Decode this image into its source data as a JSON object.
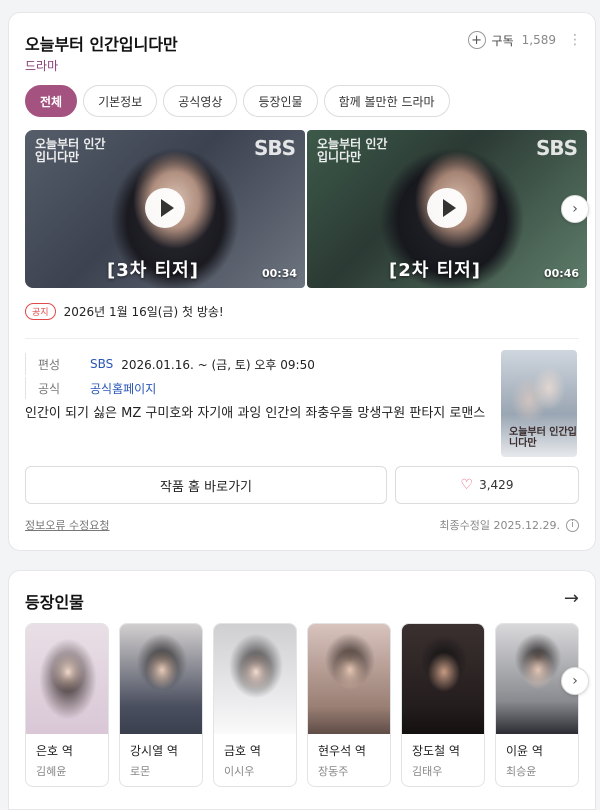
{
  "header": {
    "title": "오늘부터 인간입니다만",
    "category": "드라마",
    "subscribe_label": "구독",
    "subscribe_count": "1,589"
  },
  "tabs": [
    {
      "label": "전체",
      "active": true
    },
    {
      "label": "기본정보"
    },
    {
      "label": "공식영상"
    },
    {
      "label": "등장인물"
    },
    {
      "label": "함께 볼만한 드라마"
    }
  ],
  "videos": [
    {
      "channel": "SBS",
      "logo_text": "오늘부터 인간입니다만",
      "caption": "[3차 티저]",
      "duration": "00:34"
    },
    {
      "channel": "SBS",
      "logo_text": "오늘부터 인간입니다만",
      "caption": "[2차 티저]",
      "duration": "00:46"
    }
  ],
  "notice": {
    "badge": "공지",
    "text": "2026년 1월 16일(금) 첫 방송!"
  },
  "info": {
    "schedule_key": "편성",
    "broadcaster": "SBS",
    "schedule_value": "2026.01.16. ~  (금, 토) 오후 09:50",
    "official_key": "공식",
    "official_link": "공식홈페이지",
    "description": "인간이 되기 싫은 MZ 구미호와 자기애 과잉 인간의 좌충우돌 망생구원 판타지 로맨스",
    "poster_text": "오늘부터 인간입니다만"
  },
  "actions": {
    "home_button": "작품 홈 바로가기",
    "like_count": "3,429"
  },
  "footer": {
    "report_link": "정보오류 수정요청",
    "updated": "최종수정일 2025.12.29."
  },
  "cast": {
    "title": "등장인물",
    "items": [
      {
        "role": "은호 역",
        "actor": "김혜윤"
      },
      {
        "role": "강시열 역",
        "actor": "로몬"
      },
      {
        "role": "금호 역",
        "actor": "이시우"
      },
      {
        "role": "현우석 역",
        "actor": "장동주"
      },
      {
        "role": "장도철 역",
        "actor": "김태우"
      },
      {
        "role": "이윤 역",
        "actor": "최승윤"
      }
    ]
  },
  "colors": {
    "accent": "#a4527f",
    "category": "#8a3f78",
    "link": "#2a55b6",
    "notice": "#e04a4a"
  }
}
